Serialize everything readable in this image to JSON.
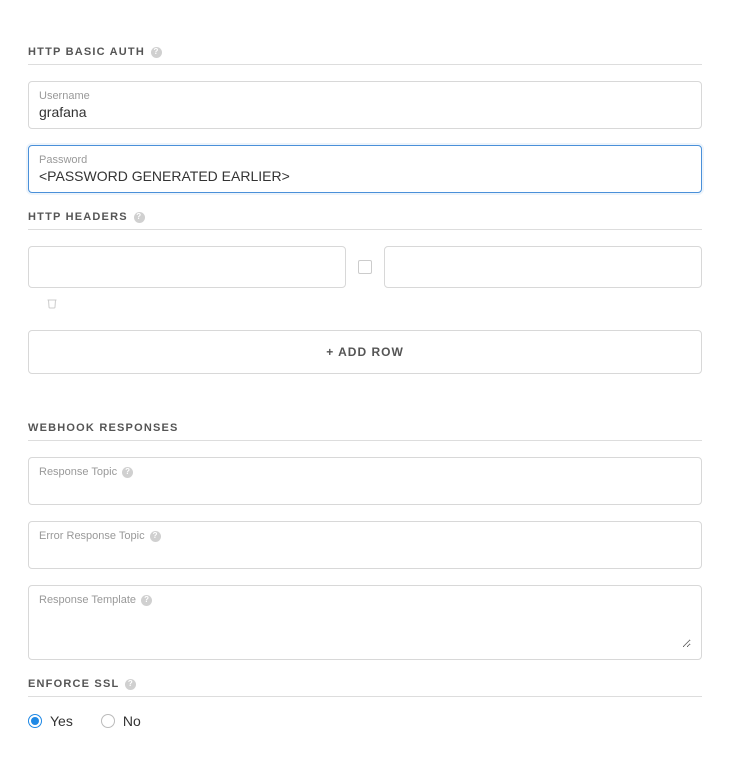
{
  "sections": {
    "basic_auth": {
      "title": "HTTP BASIC AUTH",
      "username_label": "Username",
      "username_value": "grafana",
      "password_label": "Password",
      "password_value": "<PASSWORD GENERATED EARLIER>"
    },
    "http_headers": {
      "title": "HTTP HEADERS",
      "header_key": "",
      "header_value": "",
      "add_row_label": "+ ADD ROW"
    },
    "webhook_responses": {
      "title": "WEBHOOK RESPONSES",
      "response_topic_label": "Response Topic",
      "response_topic_value": "",
      "error_response_topic_label": "Error Response Topic",
      "error_response_topic_value": "",
      "response_template_label": "Response Template",
      "response_template_value": ""
    },
    "enforce_ssl": {
      "title": "ENFORCE SSL",
      "yes_label": "Yes",
      "no_label": "No",
      "selected": "yes"
    }
  }
}
